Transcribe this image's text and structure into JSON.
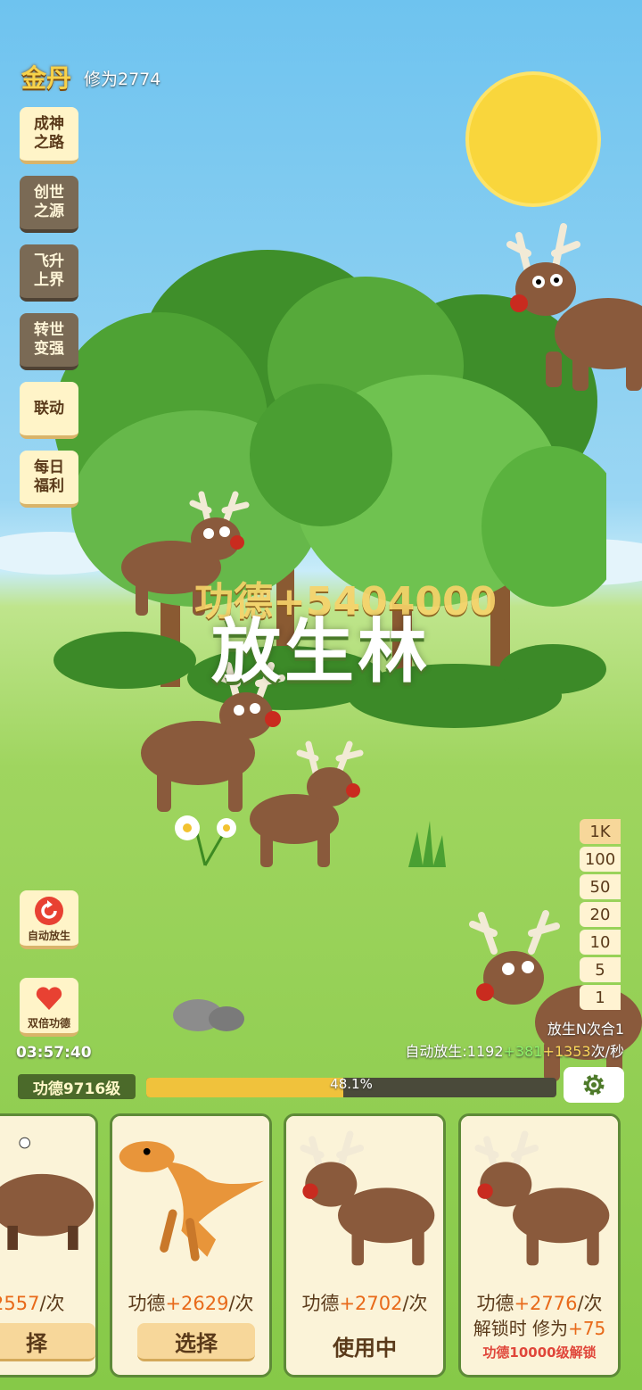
{
  "header": {
    "realm": "金丹",
    "cultivation": "修为2774"
  },
  "side_menu": [
    {
      "label": "成神\n之路",
      "style": "light"
    },
    {
      "label": "创世\n之源",
      "style": "dark"
    },
    {
      "label": "飞升\n上界",
      "style": "dark"
    },
    {
      "label": "转世\n变强",
      "style": "dark"
    },
    {
      "label": "联动",
      "style": "light"
    },
    {
      "label": "每日\n福利",
      "style": "light"
    }
  ],
  "auto_release_button": {
    "label": "自动放生",
    "icon": "refresh-icon"
  },
  "double_merit_button": {
    "label": "双倍功德",
    "icon": "heart-icon"
  },
  "timer": "03:57:40",
  "scene_title": "放生林",
  "merit_popup": "功德+5404000",
  "multipliers": [
    "1K",
    "100",
    "50",
    "20",
    "10",
    "5",
    "1"
  ],
  "multiplier_active": "1K",
  "release_info": "放生N次合1",
  "auto_release": {
    "prefix": "自动放生:",
    "base": "1192",
    "bonus1": "+381",
    "bonus2": "+1353",
    "suffix": "次/秒"
  },
  "level": {
    "label": "功德9716级",
    "progress": 0.481,
    "progress_text": "48.1%"
  },
  "colors": {
    "accent": "#f0c23c",
    "positive": "#8ef26a",
    "bonus": "#ffd75a",
    "unlock_red": "#e0463a"
  },
  "cards": [
    {
      "animal": "boar",
      "merit_prefix": "",
      "merit_num": "2557",
      "merit_suffix": "/次",
      "button": "择",
      "state": "select"
    },
    {
      "animal": "raptor",
      "merit_prefix": "功德",
      "merit_num": "+2629",
      "merit_suffix": "/次",
      "button": "选择",
      "state": "select"
    },
    {
      "animal": "reindeer",
      "merit_prefix": "功德",
      "merit_num": "+2702",
      "merit_suffix": "/次",
      "button": "使用中",
      "state": "in-use"
    },
    {
      "animal": "reindeer",
      "merit_prefix": "功德",
      "merit_num": "+2776",
      "merit_suffix": "/次",
      "unlock_text": "解锁时 修为",
      "unlock_num": "+75",
      "unlock_req": "功德10000级解锁",
      "state": "locked"
    }
  ]
}
